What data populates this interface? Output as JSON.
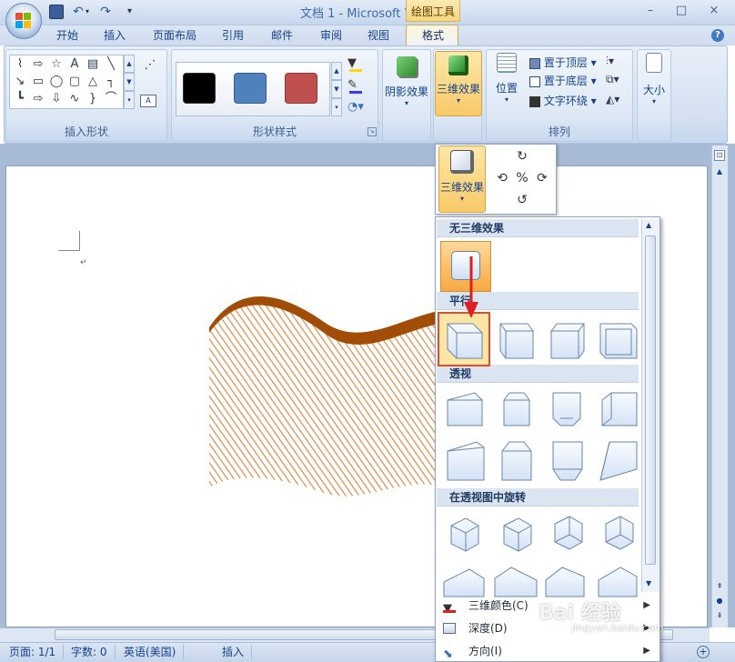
{
  "window": {
    "title": "文档 1 - Microsoft Word",
    "context_tab_header": "绘图工具",
    "controls": [
      "–",
      "□",
      "×"
    ]
  },
  "tabs": [
    "开始",
    "插入",
    "页面布局",
    "引用",
    "邮件",
    "审阅",
    "视图",
    "格式"
  ],
  "active_tab": "格式",
  "ribbon": {
    "groups": {
      "insert_shapes": "插入形状",
      "shape_styles": "形状样式",
      "arrange": "排列"
    },
    "shadow_effects": "阴影效果",
    "three_d_effects": "三维效果",
    "position": "位置",
    "bring_to_front": "置于顶层",
    "send_to_back": "置于底层",
    "text_wrapping": "文字环绕",
    "size": "大小",
    "swatch_colors": [
      "#000000",
      "#4f81bd",
      "#c0504d"
    ]
  },
  "popup": {
    "button_label": "三维效果"
  },
  "gallery": {
    "sections": {
      "none": "无三维效果",
      "parallel": "平行",
      "perspective": "透视",
      "rotation_in_perspective": "在透视图中旋转"
    },
    "menu": [
      {
        "label": "三维颜色(C)",
        "icon": "paint-bucket-icon"
      },
      {
        "label": "深度(D)",
        "icon": "depth-icon"
      },
      {
        "label": "方向(I)",
        "icon": "direction-icon"
      }
    ]
  },
  "status": {
    "page": "页面: 1/1",
    "words": "字数: 0",
    "language": "英语(美国)",
    "mode": "插入"
  },
  "watermark": {
    "text": "Bai 经验",
    "url": "jingyan.baidu.com"
  }
}
